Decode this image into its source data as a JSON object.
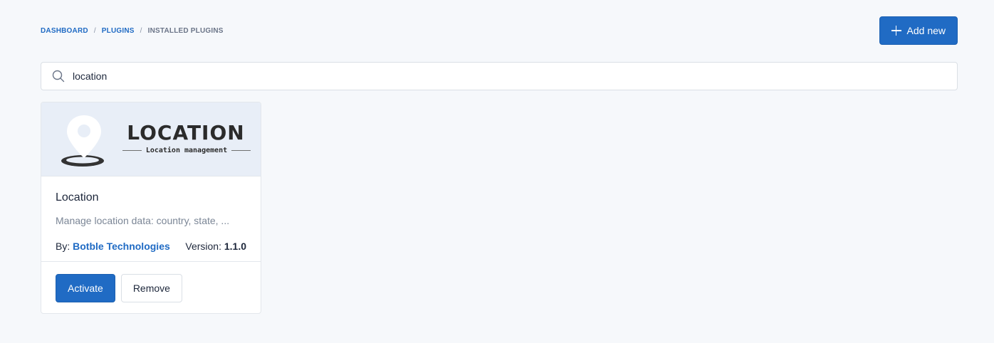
{
  "breadcrumb": {
    "items": [
      "Dashboard",
      "Plugins",
      "Installed Plugins"
    ],
    "separator": "/"
  },
  "header": {
    "add_label": "Add new",
    "add_icon": "plus-icon"
  },
  "search": {
    "value": "location",
    "icon": "search-icon"
  },
  "plugins": [
    {
      "banner_title": "LOCATION",
      "banner_subtitle": "Location management",
      "name": "Location",
      "description": "Manage location data: country, state, ...",
      "by_label": "By:",
      "author": "Botble Technologies",
      "version_label": "Version:",
      "version": "1.1.0",
      "activate_label": "Activate",
      "remove_label": "Remove"
    }
  ],
  "colors": {
    "primary": "#206bc4",
    "background": "#f6f8fb",
    "banner_bg": "#e8eef7"
  }
}
